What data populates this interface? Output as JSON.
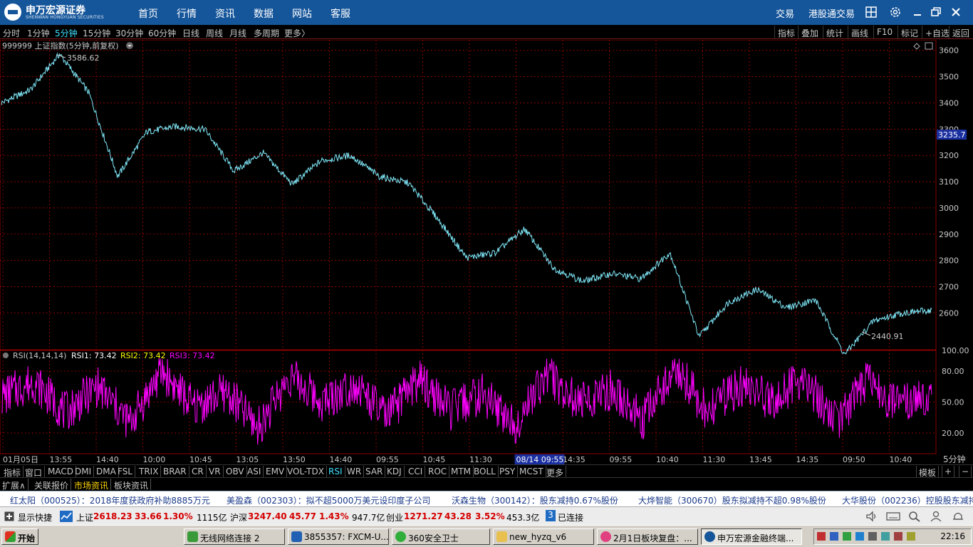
{
  "app": {
    "logo_cn": "申万宏源证券",
    "logo_en": "SHENWAN HONGYUAN SECURITIES",
    "nav": [
      "首页",
      "行情",
      "资讯",
      "数据",
      "网站",
      "客服"
    ],
    "right_links": [
      "交易",
      "港股通交易"
    ]
  },
  "periods": [
    "分时",
    "1分钟",
    "5分钟",
    "15分钟",
    "30分钟",
    "60分钟",
    "日线",
    "周线",
    "月线",
    "多周期",
    "更多〉"
  ],
  "active_period": "5分钟",
  "tools": [
    "指标",
    "叠加",
    "统计",
    "画线",
    "F10",
    "标记",
    "+自选",
    "返回"
  ],
  "main_chart": {
    "title": "999999 上证指数(5分钟,前复权)",
    "current_label": "3235.7",
    "high_label": "3586.62",
    "low_label": "2440.91"
  },
  "rsi": {
    "name": "RSI(14,14,14)",
    "rsi1": "RSI1: 73.42",
    "rsi2": "RSI2: 73.42",
    "rsi3": "RSI3: 73.42"
  },
  "chart_data": [
    {
      "type": "line",
      "y_ticks": [
        "3600",
        "3500",
        "3400",
        "3300",
        "3200",
        "3100",
        "3000",
        "2900",
        "2800",
        "2700",
        "2600"
      ],
      "ylim": [
        2460,
        3640
      ],
      "grid": true,
      "x_ticks": [
        "01月05日",
        "13:55",
        "14:40",
        "10:00",
        "10:45",
        "13:05",
        "13:50",
        "14:40",
        "09:55",
        "10:45",
        "11:30",
        "08/14 09:55",
        "14:35",
        "09:55",
        "10:40",
        "11:30",
        "13:45",
        "14:35",
        "09:50",
        "10:40"
      ],
      "series": [
        {
          "values": [
            3400,
            3450,
            3586,
            3440,
            3120,
            3290,
            3310,
            3300,
            3140,
            3210,
            3090,
            3180,
            3200,
            3120,
            3095,
            2960,
            2810,
            2830,
            2920,
            2770,
            2720,
            2750,
            2730,
            2830,
            2510,
            2640,
            2690,
            2620,
            2650,
            2441,
            2570,
            2600,
            2610
          ]
        }
      ]
    },
    {
      "type": "line",
      "y_ticks": [
        "100.00",
        "80.00",
        "50.00",
        "20.00"
      ],
      "ylim": [
        0,
        100
      ],
      "grid": true,
      "series": [
        {
          "values": [
            55,
            70,
            40,
            65,
            30,
            80,
            45,
            60,
            25,
            75,
            50,
            68,
            35,
            72,
            42,
            58,
            28,
            78,
            48,
            62,
            33,
            85,
            40,
            66,
            52,
            74,
            30,
            70,
            45,
            60
          ]
        }
      ]
    }
  ],
  "timeframe_label": "5分钟",
  "indicators": [
    "指标",
    "窗口",
    "MACD",
    "DMI",
    "DMA",
    "FSL",
    "TRIX",
    "BRAR",
    "CR",
    "VR",
    "OBV",
    "ASI",
    "EMV",
    "VOL-TDX",
    "RSI",
    "WR",
    "SAR",
    "KDJ",
    "CCI",
    "ROC",
    "MTM",
    "BOLL",
    "PSY",
    "MCST",
    "更多"
  ],
  "active_indicator": "RSI",
  "indicator_right": [
    "模板",
    "+",
    "−"
  ],
  "info_tabs": [
    "扩展∧",
    "关联报价",
    "市场资讯",
    "板块资讯"
  ],
  "active_info": "市场资讯",
  "news": [
    "红太阳（000525）：2018年度获政府补助8885万元",
    "美盈森（002303）：拟不超5000万美元设印度子公司",
    "沃森生物（300142）：股东减持0.67%股份",
    "大烨智能（300670）股东拟减持不超0.98%股份",
    "大华股份（002236）控股股东减持"
  ],
  "status": {
    "shortcut": "显示快捷",
    "sh_name": "上证",
    "sh_value": "2618.23",
    "sh_change": "33.66",
    "sh_pct": "1.30%",
    "sh_vol": "1115亿",
    "hs_name": "沪深",
    "hs_value": "3247.40",
    "hs_change": "45.77",
    "hs_pct": "1.43%",
    "hs_vol": "947.7亿",
    "cy_name": "创业",
    "cy_value": "1271.27",
    "cy_change": "43.28",
    "cy_pct": "3.52%",
    "cy_vol": "453.3亿",
    "conn_num": "3",
    "conn_text": "已连接"
  },
  "taskbar": {
    "start": "开始",
    "tasks": [
      "无线网络连接 2",
      "3855357: FXCM-U...",
      "360安全卫士",
      "new_hyzq_v6",
      "2月1日板块复盘：...",
      "申万宏源金融终端..."
    ],
    "clock": "22:16"
  },
  "colors": {
    "nav_bg": "#15559a",
    "price_line": "#7fe8f8",
    "rsi_line": "#ff00ff",
    "grid": "#8b0000",
    "up_red": "#d40000"
  }
}
